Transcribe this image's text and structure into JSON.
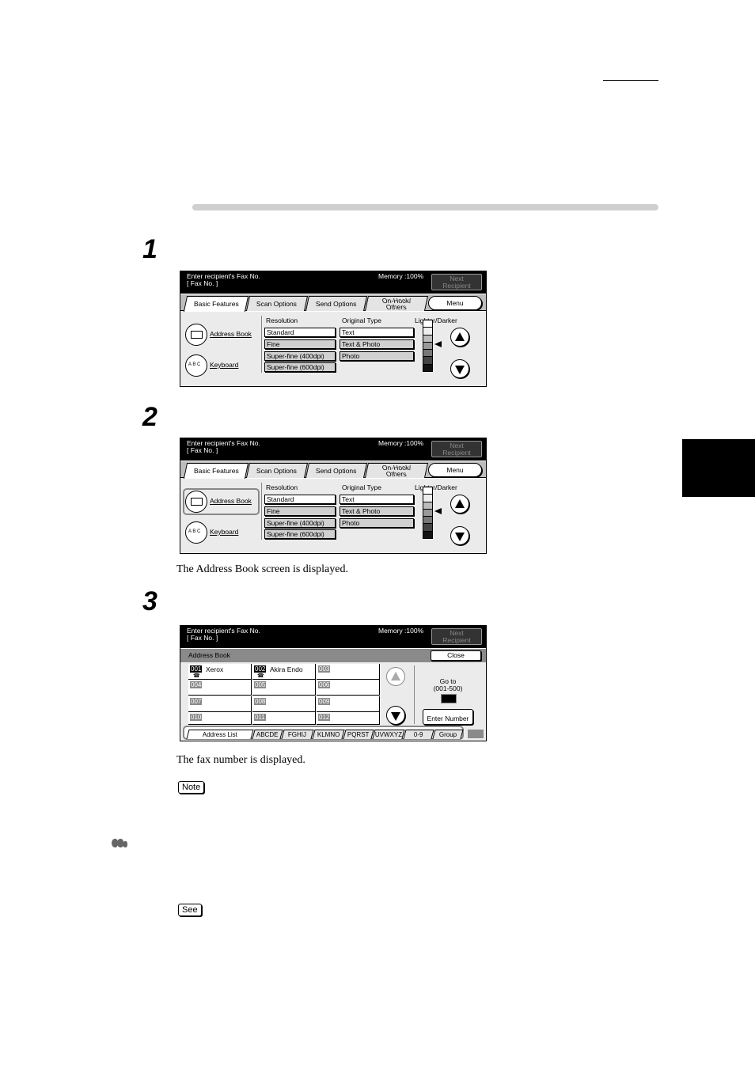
{
  "steps": [
    "1",
    "2",
    "3"
  ],
  "captions": {
    "step2": "The Address Book screen is displayed.",
    "step3": "The fax number is displayed."
  },
  "labels": {
    "note": "Note",
    "see": "See"
  },
  "panel": {
    "header_line1": "Enter recipient's Fax No.",
    "header_line2": "[  Fax No. ]",
    "memory": "Memory :100%",
    "next_recipient": [
      "Next",
      "Recipient"
    ],
    "tabs": [
      "Basic Features",
      "Scan Options",
      "Send Options"
    ],
    "tab_onhook": [
      "On-Hook/",
      "Others"
    ],
    "menu": "Menu",
    "address_book": "Address Book",
    "keyboard": "Keyboard",
    "abc": "A B C",
    "resolution_label": "Resolution",
    "resolution_options": [
      "Standard",
      "Fine",
      "Super-fine (400dpi)",
      "Super-fine (600dpi)"
    ],
    "original_type_label": "Original Type",
    "original_type_options": [
      "Text",
      "Text & Photo",
      "Photo"
    ],
    "lighter_darker": "Lighter/Darker"
  },
  "address_book_panel": {
    "title": "Address Book",
    "close": "Close",
    "entries": [
      {
        "num": "001",
        "name": "Xerox",
        "phone": "☎"
      },
      {
        "num": "002",
        "name": "Akira Endo",
        "phone": "☎"
      },
      {
        "num": "003",
        "name": ""
      },
      {
        "num": "004",
        "name": ""
      },
      {
        "num": "005",
        "name": ""
      },
      {
        "num": "006",
        "name": ""
      },
      {
        "num": "007",
        "name": ""
      },
      {
        "num": "008",
        "name": ""
      },
      {
        "num": "009",
        "name": ""
      },
      {
        "num": "010",
        "name": ""
      },
      {
        "num": "011",
        "name": ""
      },
      {
        "num": "012",
        "name": ""
      }
    ],
    "goto_line1": "Go to",
    "goto_line2": "(001-500)",
    "enter_number": "Enter Number",
    "index_tabs": [
      "Address List",
      "ABCDE",
      "FGHIJ",
      "KLMNO",
      "PQRST",
      "UVWXYZ",
      "0-9",
      "Group"
    ]
  }
}
